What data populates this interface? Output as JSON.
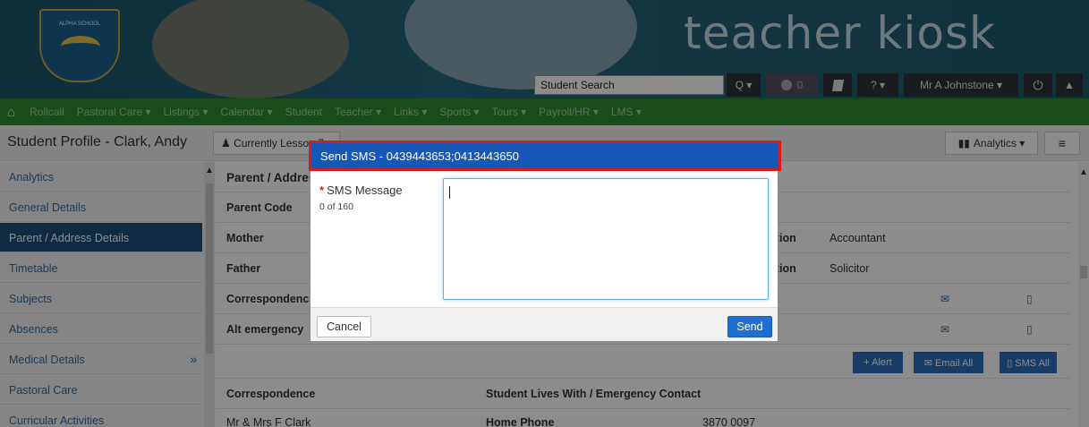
{
  "header": {
    "school_logo_text": "ALPHA SCHOOL",
    "app_title": "teacher kiosk",
    "search_value": "Student Search",
    "search_dropdown": "Q ▾",
    "notifications_count": "0",
    "user_name": "Mr A Johnstone ▾",
    "help_label": "? ▾"
  },
  "nav": {
    "items": [
      "Rollcall",
      "Pastoral Care ▾",
      "Listings ▾",
      "Calendar ▾",
      "Student",
      "Teacher ▾",
      "Links ▾",
      "Sports ▾",
      "Tours ▾",
      "Payroll/HR ▾",
      "LMS ▾"
    ]
  },
  "subheader": {
    "title": "Student Profile - Clark, Andy",
    "lesson_button": "Currently Lesson 7 ▾",
    "analytics_button": "Analytics ▾"
  },
  "sidebar": {
    "items": [
      {
        "label": "Analytics"
      },
      {
        "label": "General Details"
      },
      {
        "label": "Parent / Address Details"
      },
      {
        "label": "Timetable"
      },
      {
        "label": "Subjects"
      },
      {
        "label": "Absences"
      },
      {
        "label": "Medical Details"
      },
      {
        "label": "Pastoral Care"
      },
      {
        "label": "Curricular Activities"
      }
    ],
    "medical_chevron": "»"
  },
  "main": {
    "section_title": "Parent / Address Details",
    "rows": [
      {
        "label": "Parent Code"
      },
      {
        "label": "Mother",
        "occupation_label": "Occupation",
        "occupation": "Accountant"
      },
      {
        "label": "Father",
        "occupation_label": "Occupation",
        "occupation": "Solicitor"
      },
      {
        "label": "Correspondence"
      },
      {
        "label": "Alt emergency"
      }
    ],
    "actions": {
      "alert": "+ Alert",
      "email_all": "✉ Email All",
      "sms_all": "▯ SMS All"
    },
    "bottom_headers": {
      "left": "Correspondence",
      "right": "Student Lives With / Emergency Contact"
    },
    "bottom_row": {
      "name": "Mr & Mrs F Clark",
      "phone_label": "Home Phone",
      "phone": "3870 0097"
    }
  },
  "modal": {
    "title": "Send SMS - 0439443653;0413443650",
    "field_label": "SMS Message",
    "required_mark": "*",
    "counter": "0 of 160",
    "message_value": "",
    "cancel_label": "Cancel",
    "send_label": "Send"
  }
}
